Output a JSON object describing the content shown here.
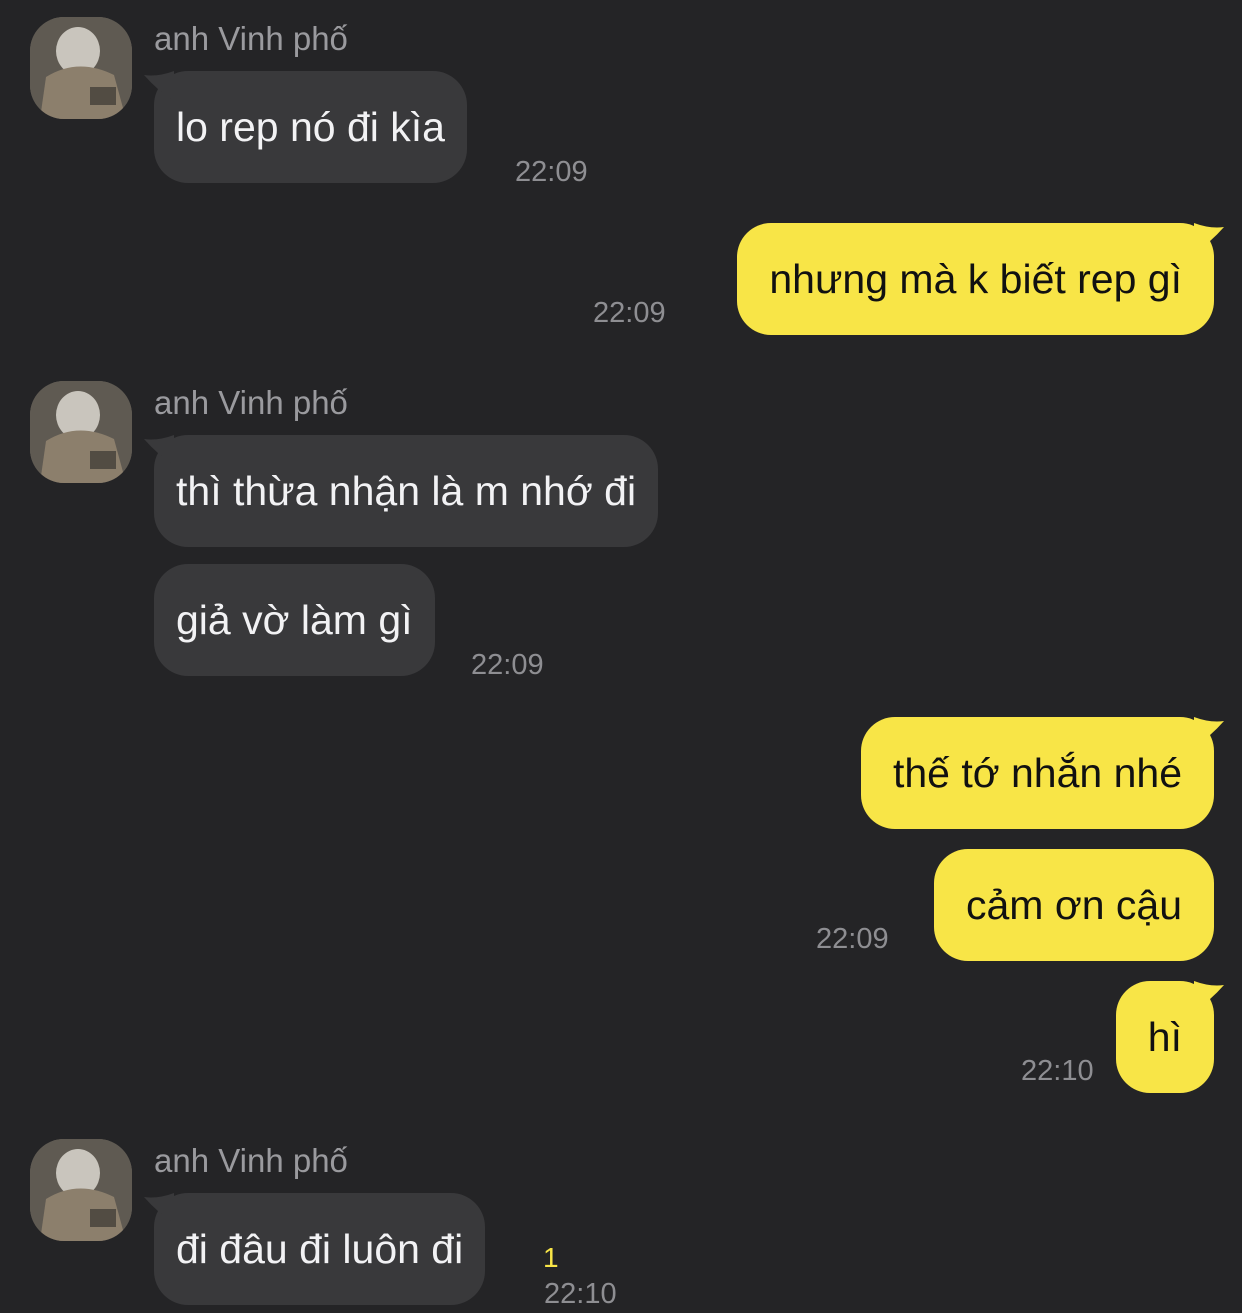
{
  "contact": {
    "name": "anh Vinh phố"
  },
  "colors": {
    "background": "#242426",
    "incoming_bubble": "#39393b",
    "outgoing_bubble": "#f8e547",
    "timestamp": "#8e8e92",
    "unread": "#f8e547"
  },
  "messages": [
    {
      "sender": "anh Vinh phố",
      "text": "lo rep nó đi kìa",
      "time": "22:09"
    },
    {
      "text": "nhưng mà k biết rep gì",
      "time": "22:09"
    },
    {
      "sender": "anh Vinh phố",
      "text": "thì thừa nhận là m nhớ đi"
    },
    {
      "text": "giả vờ làm gì",
      "time": "22:09"
    },
    {
      "text": "thế tớ nhắn nhé"
    },
    {
      "text": "cảm ơn cậu",
      "time": "22:09"
    },
    {
      "text": "hì",
      "time": "22:10"
    },
    {
      "sender": "anh Vinh phố",
      "text": "đi đâu đi luôn đi",
      "time": "22:10",
      "unread_count": "1"
    }
  ]
}
